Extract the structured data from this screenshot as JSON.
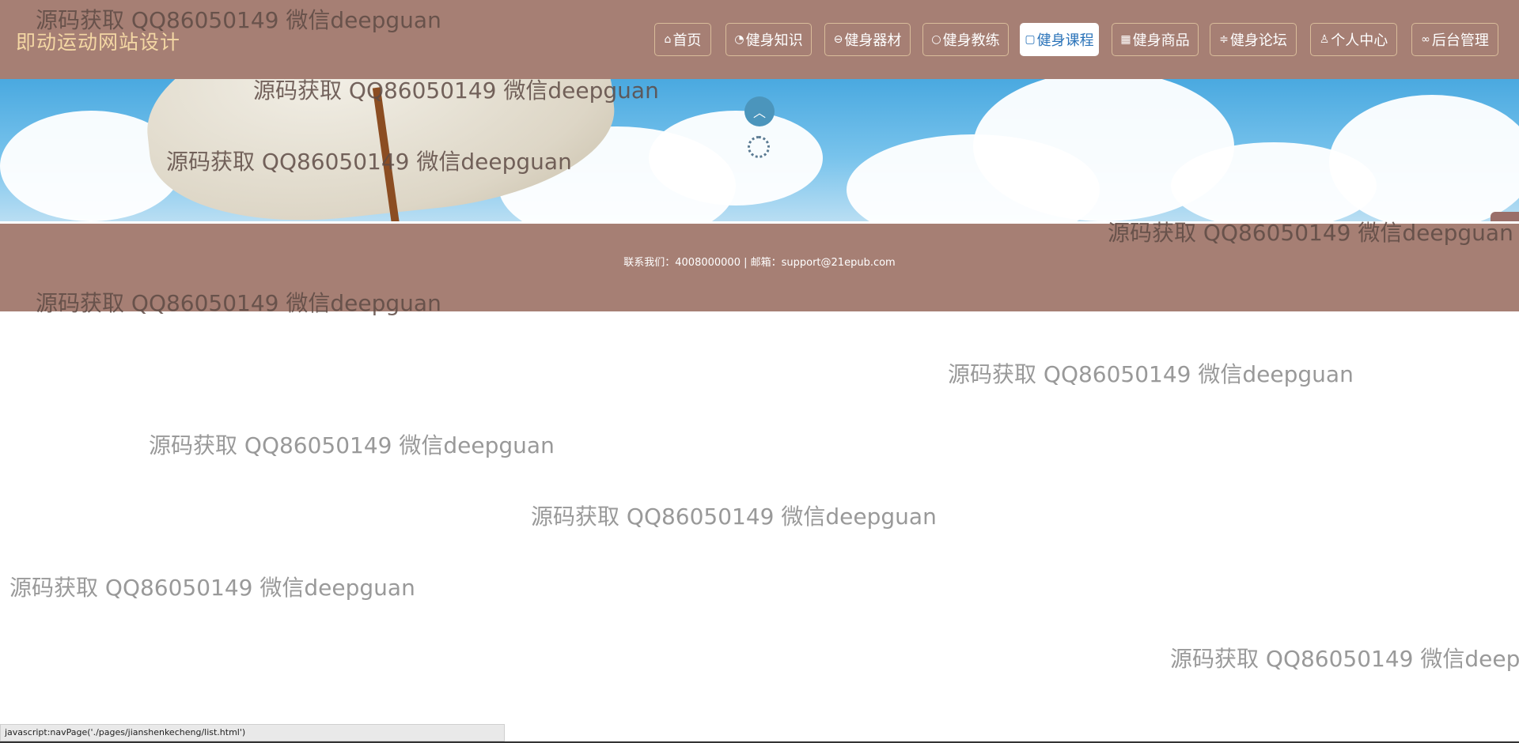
{
  "site": {
    "title": "即动运动网站设计"
  },
  "nav": [
    {
      "label": "首页",
      "icon": "home-icon",
      "glyph": "⌂"
    },
    {
      "label": "健身知识",
      "icon": "knowledge-icon",
      "glyph": "◔"
    },
    {
      "label": "健身器材",
      "icon": "equipment-icon",
      "glyph": "⊖"
    },
    {
      "label": "健身教练",
      "icon": "coach-icon",
      "glyph": "○"
    },
    {
      "label": "健身课程",
      "icon": "course-icon",
      "glyph": "▢",
      "active": true
    },
    {
      "label": "健身商品",
      "icon": "shop-icon",
      "glyph": "▦"
    },
    {
      "label": "健身论坛",
      "icon": "forum-icon",
      "glyph": "≑"
    },
    {
      "label": "个人中心",
      "icon": "user-icon",
      "glyph": "♙"
    },
    {
      "label": "后台管理",
      "icon": "link-icon",
      "glyph": "∞"
    }
  ],
  "footer": {
    "contact": "联系我们：4008000000 | 邮箱：support@21epub.com"
  },
  "watermark": "源码获取 QQ86050149 微信deepguan",
  "statusbar": {
    "text": "javascript:navPage('./pages/jianshenkecheng/list.html')"
  },
  "colors": {
    "header_bg": "#a67f74",
    "title": "#f4d7a4",
    "active_text": "#2a73b9"
  }
}
